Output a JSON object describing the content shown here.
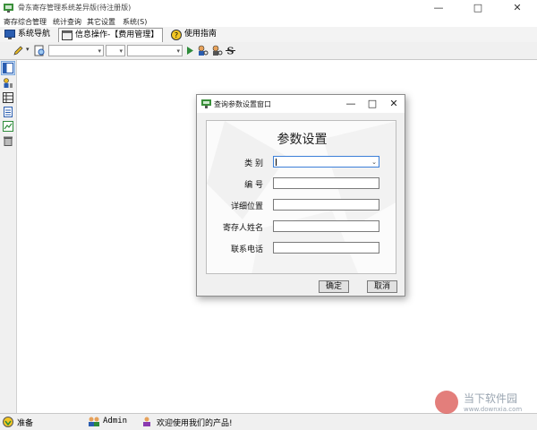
{
  "window": {
    "title": "骨东寄存管理系统差异版(待注册版)",
    "buttons": [
      "—",
      "□",
      "✕"
    ]
  },
  "menu": [
    "寄存综合管理",
    "统计查询",
    "其它设置",
    "系统(S)"
  ],
  "tabs": [
    {
      "label": "系统导航",
      "icon": "monitor-icon"
    },
    {
      "label": "信息操作-【费用管理】",
      "icon": "window-icon"
    },
    {
      "label": "使用指南",
      "icon": "help-icon"
    }
  ],
  "toolbar": {
    "icons": [
      "pencil-icon",
      "preview-icon",
      "play-icon",
      "find-user-icon",
      "find-user-icon-2",
      "strikethrough-icon"
    ]
  },
  "sidebar": {
    "icons": [
      "panel-icon",
      "key-user-icon",
      "table-icon",
      "document-icon",
      "chart-icon",
      "trash-icon"
    ]
  },
  "dialog": {
    "title": "查询参数设置窗口",
    "heading": "参数设置",
    "fields": [
      {
        "label": "类    别",
        "type": "select",
        "value": ""
      },
      {
        "label": "编    号",
        "type": "text",
        "value": ""
      },
      {
        "label": "详细位置",
        "type": "text",
        "value": ""
      },
      {
        "label": "寄存人姓名",
        "type": "text",
        "value": ""
      },
      {
        "label": "联系电话",
        "type": "text",
        "value": ""
      }
    ],
    "ok_label": "确定",
    "cancel_label": "取消",
    "title_buttons": [
      "—",
      "□",
      "✕"
    ]
  },
  "status": {
    "ready": "准备",
    "user": "Admin",
    "welcome": "欢迎使用我们的产品!"
  },
  "watermark": {
    "name": "当下软件园",
    "url": "www.downxia.com"
  },
  "colors": {
    "accent_green": "#2e8b3a",
    "dialog_bg": "#f0f0f0",
    "select_focus": "#3c7fd8"
  }
}
